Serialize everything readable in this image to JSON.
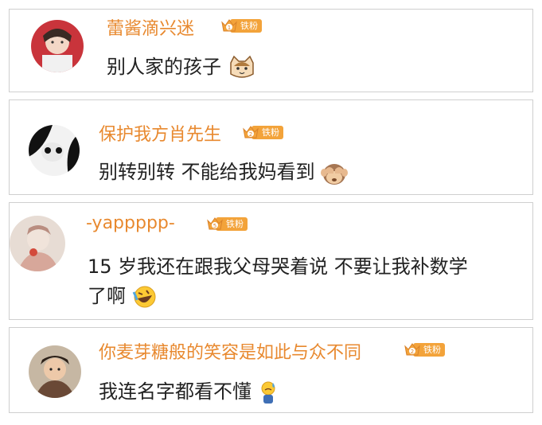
{
  "comments": [
    {
      "username": "蕾酱滴兴迷",
      "badge_level": "1",
      "badge_label": "铁粉",
      "text": "别人家的孩子",
      "emoji": "cat-face-emoji"
    },
    {
      "username": "保护我方肖先生",
      "badge_level": "2",
      "badge_label": "铁粉",
      "text": "别转别转 不能给我妈看到",
      "emoji": "see-no-evil-monkey-emoji"
    },
    {
      "username": "-yappppp-",
      "badge_level": "5",
      "badge_label": "铁粉",
      "text_line1": "15 岁我还在跟我父母哭着说 不要让我补数学",
      "text_line2": "了啊",
      "emoji": "rolling-laughing-emoji"
    },
    {
      "username": "你麦芽糖般的笑容是如此与众不同",
      "badge_level": "2",
      "badge_label": "铁粉",
      "text": "我连名字都看不懂",
      "emoji": "sweat-emoji"
    }
  ],
  "colors": {
    "username": "#e8892f",
    "badge_bg": "#f3a33a",
    "text": "#222222",
    "border": "#cfcfcf"
  }
}
